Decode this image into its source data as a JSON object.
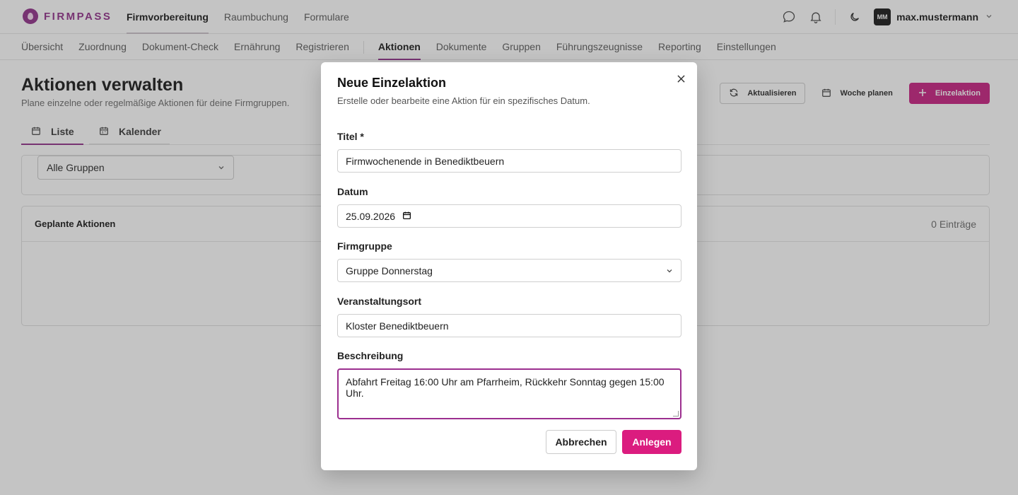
{
  "app": {
    "logo_text": "FIRMPASS",
    "brand_color": "#8e2a86",
    "accent_color": "#db1c7f"
  },
  "topnav": {
    "items": [
      {
        "label": "Firmvorbereitung",
        "active": true
      },
      {
        "label": "Raumbuchung",
        "active": false
      },
      {
        "label": "Formulare",
        "active": false
      }
    ]
  },
  "user": {
    "initials": "MM",
    "name": "max.mustermann"
  },
  "subnav": {
    "items": [
      {
        "label": "Übersicht"
      },
      {
        "label": "Zuordnung"
      },
      {
        "label": "Dokument-Check"
      },
      {
        "label": "Ernährung"
      },
      {
        "label": "Registrieren"
      },
      {
        "label": "Aktionen",
        "active": true
      },
      {
        "label": "Dokumente"
      },
      {
        "label": "Gruppen"
      },
      {
        "label": "Führungszeugnisse"
      },
      {
        "label": "Reporting"
      },
      {
        "label": "Einstellungen"
      }
    ]
  },
  "page": {
    "title": "Aktionen verwalten",
    "subtitle": "Plane einzelne oder regelmäßige Aktionen für deine Firmgruppen.",
    "actions": {
      "refresh": "Aktualisieren",
      "plan_week": "Woche planen",
      "single_action": "Einzelaktion"
    },
    "tabs": [
      {
        "label": "Liste",
        "active": true
      },
      {
        "label": "Kalender",
        "active": false
      }
    ],
    "filter": {
      "group_select": "Alle Gruppen"
    },
    "list": {
      "title": "Geplante Aktionen",
      "count": "0 Einträge"
    }
  },
  "modal": {
    "title": "Neue Einzelaktion",
    "subtitle": "Erstelle oder bearbeite eine Aktion für ein spezifisches Datum.",
    "fields": {
      "title_label": "Titel *",
      "title_value": "Firmwochenende in Benediktbeuern",
      "date_label": "Datum",
      "date_value": "25.09.2026",
      "group_label": "Firmgruppe",
      "group_value": "Gruppe Donnerstag",
      "location_label": "Veranstaltungsort",
      "location_value": "Kloster Benediktbeuern",
      "description_label": "Beschreibung",
      "description_value": "Abfahrt Freitag 16:00 Uhr am Pfarrheim, Rückkehr Sonntag gegen 15:00 Uhr."
    },
    "buttons": {
      "cancel": "Abbrechen",
      "create": "Anlegen"
    }
  }
}
